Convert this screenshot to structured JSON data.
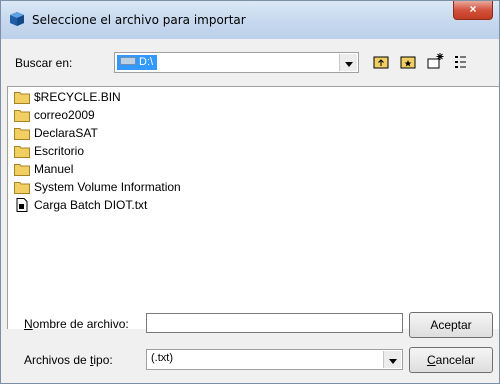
{
  "dialog": {
    "title": "Seleccione el archivo para importar",
    "close_symbol": "×"
  },
  "lookin": {
    "label": "Buscar en:",
    "value": "D:\\",
    "icon": "drive-icon"
  },
  "toolbar": {
    "buttons": [
      {
        "name": "up-folder-icon"
      },
      {
        "name": "desktop-icon"
      },
      {
        "name": "new-folder-icon"
      },
      {
        "name": "list-view-icon"
      }
    ]
  },
  "files": [
    {
      "name": "$RECYCLE.BIN",
      "icon": "folder-icon"
    },
    {
      "name": "correo2009",
      "icon": "folder-icon"
    },
    {
      "name": "DeclaraSAT",
      "icon": "folder-icon"
    },
    {
      "name": "Escritorio",
      "icon": "folder-icon"
    },
    {
      "name": "Manuel",
      "icon": "folder-icon"
    },
    {
      "name": "System Volume Information",
      "icon": "folder-icon"
    },
    {
      "name": "Carga Batch DIOT.txt",
      "icon": "text-file-icon"
    }
  ],
  "filename": {
    "label_accel": "N",
    "label_rest": "ombre de archivo:",
    "value": ""
  },
  "filetype": {
    "label_pre": "Archivos de ",
    "label_accel": "t",
    "label_post": "ipo:",
    "value": "(.txt)"
  },
  "buttons": {
    "accept": "Aceptar",
    "cancel_accel": "C",
    "cancel_rest": "ancelar"
  },
  "colors": {
    "folder": "#f2cf63",
    "selection": "#3399ff",
    "close": "#c23b22"
  }
}
